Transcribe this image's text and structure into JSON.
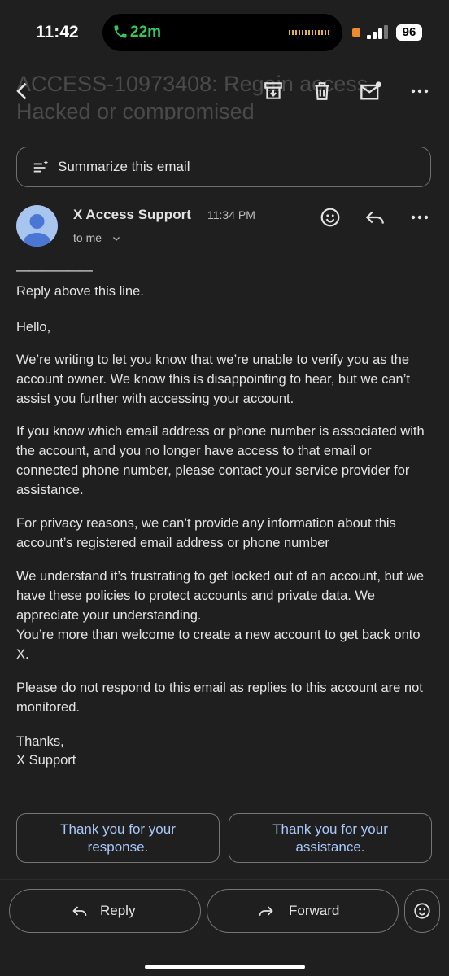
{
  "status_bar": {
    "time": "11:42",
    "call_duration": "22m",
    "battery": "96"
  },
  "header": {
    "subject_ghost": "ACCESS-10973408: Regain access - Hacked or compromised",
    "icons": [
      "back-arrow-icon",
      "archive-icon",
      "trash-icon",
      "mark-unread-icon",
      "more-icon"
    ]
  },
  "summarize": {
    "label": "Summarize this email"
  },
  "message": {
    "sender": "X Access Support",
    "time": "11:34 PM",
    "recipient": "to me",
    "separator": "——————",
    "paragraphs": [
      "Reply above this line.",
      "Hello,",
      "We’re writing to let you know that we’re unable to verify you as the account owner. We know this is disappointing to hear, but we can’t assist you further with accessing your account.",
      "If you know which email address or phone number is associated with the account, and you no longer have access to that email or connected phone number, please contact your service provider for assistance.",
      "For privacy reasons, we can’t provide any information about this account’s registered email address or phone number",
      "We understand it’s frustrating to get locked out of an account, but we have these policies to protect accounts and private data. We appreciate your understanding.",
      "You’re more than welcome to create a new account to get back onto X.",
      "Please do not respond to this email as replies to this account are not monitored.",
      "Thanks,",
      "X Support"
    ]
  },
  "smart_replies": [
    "Thank you for your response.",
    "Thank you for your assistance."
  ],
  "actions": {
    "reply": "Reply",
    "forward": "Forward"
  },
  "colors": {
    "background": "#1f1f1f",
    "text": "#e3e3e3",
    "link_blue": "#a8c7fa",
    "avatar": "#a8c5f0",
    "call_green": "#34c759"
  }
}
